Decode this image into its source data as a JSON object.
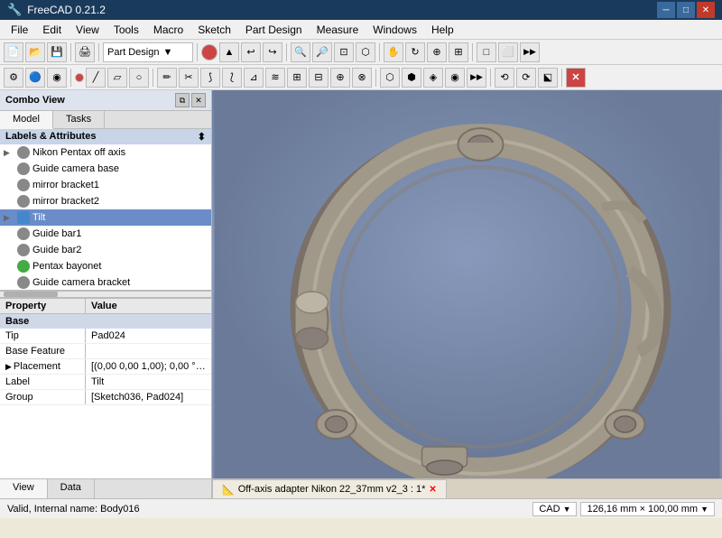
{
  "titlebar": {
    "icon": "freecad-icon",
    "title": "FreeCAD 0.21.2",
    "controls": [
      "minimize",
      "maximize",
      "close"
    ]
  },
  "menubar": {
    "items": [
      "File",
      "Edit",
      "View",
      "Tools",
      "Macro",
      "Sketch",
      "Part Design",
      "Measure",
      "Windows",
      "Help"
    ]
  },
  "toolbar1": {
    "dropdown_label": "Part Design",
    "dropdown_arrow": "▼"
  },
  "combo_view": {
    "title": "Combo View",
    "close_btn": "✕",
    "float_btn": "⧉"
  },
  "tabs": {
    "model_label": "Model",
    "tasks_label": "Tasks"
  },
  "tree": {
    "header": "Labels & Attributes",
    "items": [
      {
        "id": "item1",
        "label": "Nikon Pentax off axis",
        "indent": 1,
        "arrow": "▶",
        "icon_type": "gear"
      },
      {
        "id": "item2",
        "label": "Guide camera base",
        "indent": 1,
        "arrow": " ",
        "icon_type": "gear"
      },
      {
        "id": "item3",
        "label": "mirror bracket1",
        "indent": 1,
        "arrow": " ",
        "icon_type": "gear"
      },
      {
        "id": "item4",
        "label": "mirror bracket2",
        "indent": 1,
        "arrow": " ",
        "icon_type": "gear"
      },
      {
        "id": "item5",
        "label": "Tilt",
        "indent": 1,
        "arrow": "▶",
        "icon_type": "blue",
        "selected": true
      },
      {
        "id": "item6",
        "label": "Guide bar1",
        "indent": 1,
        "arrow": " ",
        "icon_type": "gear"
      },
      {
        "id": "item7",
        "label": "Guide bar2",
        "indent": 1,
        "arrow": " ",
        "icon_type": "gear"
      },
      {
        "id": "item8",
        "label": "Pentax bayonet",
        "indent": 1,
        "arrow": " ",
        "icon_type": "green"
      },
      {
        "id": "item9",
        "label": "Guide camera bracket",
        "indent": 1,
        "arrow": " ",
        "icon_type": "gear"
      }
    ]
  },
  "properties": {
    "col1_header": "Property",
    "col2_header": "Value",
    "section": "Base",
    "rows": [
      {
        "prop": "Tip",
        "value": "Pad024"
      },
      {
        "prop": "Base Feature",
        "value": ""
      },
      {
        "prop": "Placement",
        "value": "[(0,00 0,00 1,00); 0,00 °; (0,..."
      },
      {
        "prop": "Label",
        "value": "Tilt"
      },
      {
        "prop": "Group",
        "value": "[Sketch036, Pad024]"
      }
    ]
  },
  "bottom_tabs": {
    "view_label": "View",
    "data_label": "Data"
  },
  "viewport": {
    "tab_label": "Off-axis adapter Nikon 22_37mm v2_3 : 1*",
    "tab_close": "✕"
  },
  "statusbar": {
    "left_text": "Valid, Internal name: Body016",
    "cad_label": "CAD",
    "cad_arrow": "▼",
    "dimensions": "126,16 mm × 100,00 mm",
    "dim_arrow": "▼"
  }
}
